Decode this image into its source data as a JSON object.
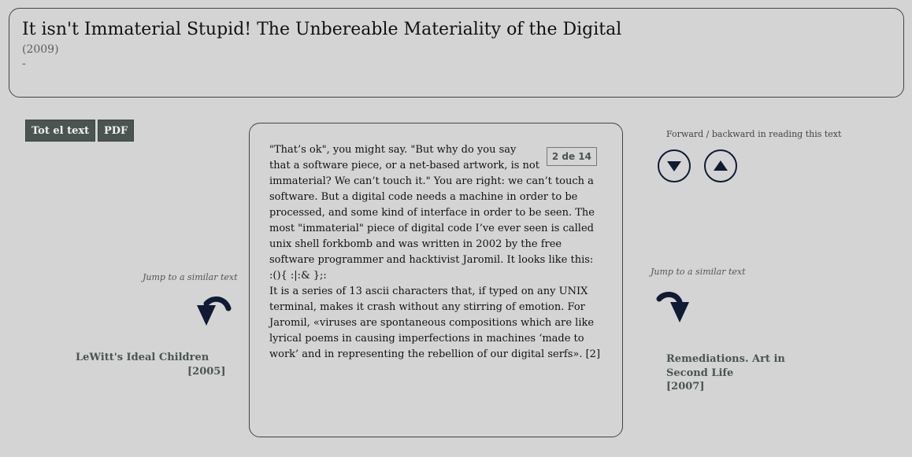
{
  "header": {
    "title": "It isn't Immaterial Stupid! The Unbereable Materiality of the Digital",
    "year": "(2009)",
    "subtitle": "-"
  },
  "buttons": {
    "tot_label": "Tot el text",
    "pdf_label": "PDF"
  },
  "reader": {
    "pager": "2 de 14",
    "paragraphs": [
      "\"That’s ok\", you might say. \"But why do you say that a software piece, or a net-based artwork, is not immaterial? We can’t touch it.\" You are right: we can’t touch a software. But a digital code needs a machine in order to be processed, and some kind of interface in order to be seen. The most \"immaterial\" piece of digital code I’ve ever seen is called unix shell forkbomb and was written in 2002 by the free software programmer and hacktivist Jaromil. It looks like this:",
      ":(){ :|:& };:",
      "It is a series of 13 ascii characters that, if typed on any UNIX terminal, makes it crash without any stirring of emotion. For Jaromil, «viruses are spontaneous compositions which are like lyrical poems in causing imperfections in machines ‘made to work’ and in representing the rebellion of our digital serfs». [2]"
    ]
  },
  "navigation": {
    "label": "Forward / backward in reading this text",
    "forward_icon": "arrow-down-icon",
    "backward_icon": "arrow-up-icon"
  },
  "similar_left": {
    "label": "Jump to a similar text",
    "icon": "curved-arrow-left-icon",
    "title": "LeWitt's Ideal Children",
    "year": "[2005]"
  },
  "similar_right": {
    "label": "Jump to a similar text",
    "icon": "curved-arrow-right-icon",
    "title": "Remediations. Art in Second Life",
    "year": "[2007]"
  }
}
